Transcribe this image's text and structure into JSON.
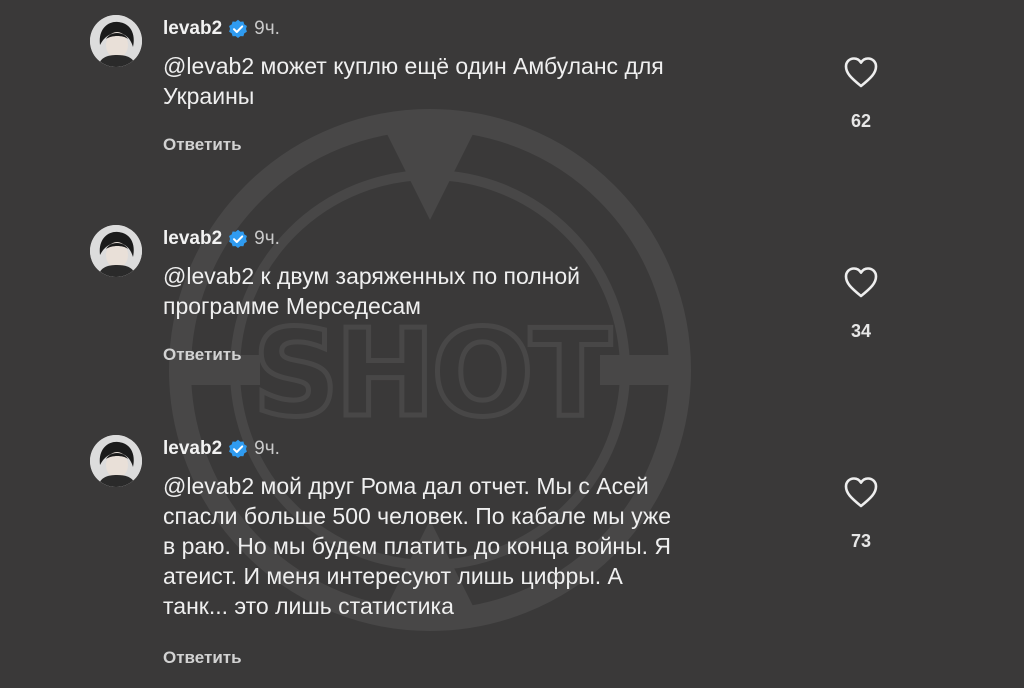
{
  "watermark": {
    "text": "SHOT"
  },
  "comments": [
    {
      "username": "levab2",
      "time": "9ч.",
      "text": "@levab2 может куплю ещё один Амбуланс для\nУкраины",
      "reply_label": "Ответить",
      "likes": "62"
    },
    {
      "username": "levab2",
      "time": "9ч.",
      "text": "@levab2 к двум заряженных по полной\nпрограмме Мерседесам",
      "reply_label": "Ответить",
      "likes": "34"
    },
    {
      "username": "levab2",
      "time": "9ч.",
      "text": "@levab2 мой друг Рома дал отчет. Мы с Асей\nспасли больше 500 человек. По кабале мы уже\nв раю. Но мы будем платить до конца войны. Я\nатеист. И меня интересуют лишь цифры. А\nтанк... это лишь статистика",
      "reply_label": "Ответить",
      "likes": "73"
    }
  ],
  "icons": {
    "verified": "verified-badge-icon",
    "like": "heart-outline-icon"
  },
  "colors": {
    "background": "#3a3939",
    "verified": "#2f9bf0",
    "text": "#efefef"
  }
}
